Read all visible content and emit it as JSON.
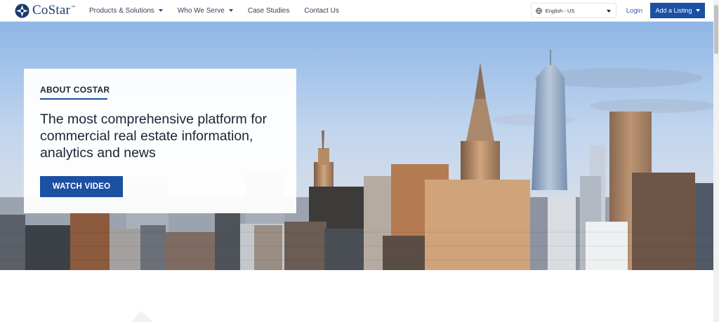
{
  "header": {
    "logo_text": "CoStar",
    "logo_tm": "™",
    "nav": [
      {
        "label": "Products & Solutions",
        "has_caret": true
      },
      {
        "label": "Who We Serve",
        "has_caret": true
      },
      {
        "label": "Case Studies",
        "has_caret": false
      },
      {
        "label": "Contact Us",
        "has_caret": false
      }
    ],
    "language": "English - US",
    "login": "Login",
    "add_listing": "Add a Listing"
  },
  "hero": {
    "eyebrow": "ABOUT COSTAR",
    "title": "The most comprehensive platform for commercial real estate information, analytics and news",
    "cta": "WATCH VIDEO"
  },
  "colors": {
    "brand_blue": "#1b50a3",
    "text_dark": "#1a2536"
  }
}
